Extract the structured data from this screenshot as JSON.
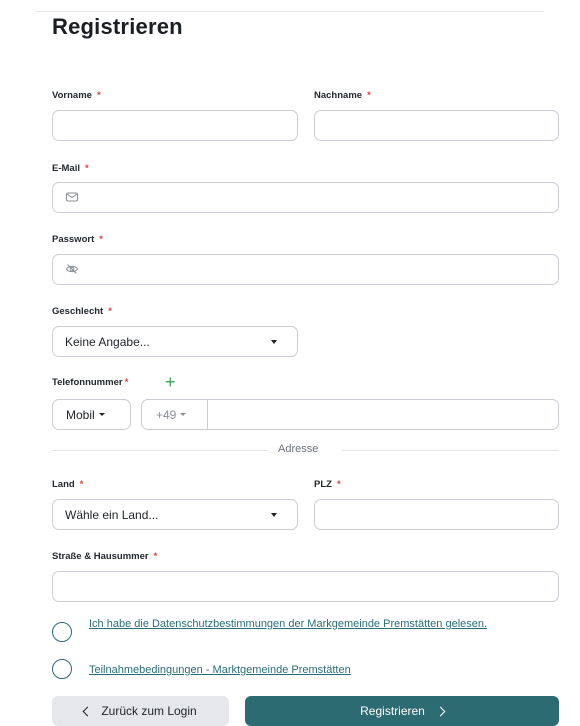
{
  "title": "Registrieren",
  "required_marker": "*",
  "fields": {
    "vorname": {
      "label": "Vorname",
      "value": ""
    },
    "nachname": {
      "label": "Nachname",
      "value": ""
    },
    "email": {
      "label": "E-Mail",
      "value": "",
      "icon": "mail-icon"
    },
    "passwort": {
      "label": "Passwort",
      "value": "",
      "icon": "eye-off-icon"
    },
    "geschlecht": {
      "label": "Geschlecht",
      "selected": "Keine Angabe..."
    },
    "telefon": {
      "label": "Telefonnummer",
      "type_selected": "Mobil",
      "prefix": "+49",
      "value": ""
    },
    "land": {
      "label": "Land",
      "selected": "Wähle ein Land..."
    },
    "plz": {
      "label": "PLZ",
      "value": ""
    },
    "strasse": {
      "label": "Straße & Hausummer",
      "value": ""
    }
  },
  "section_address": "Adresse",
  "consents": [
    {
      "text": "Ich habe die Datenschutzbestimmungen der Markgemeinde Premstätten gelesen.",
      "checked": false
    },
    {
      "text": "Teilnahmebedingungen - Marktgemeinde Premstätten",
      "checked": false
    }
  ],
  "buttons": {
    "back": "Zurück zum Login",
    "register": "Registrieren"
  },
  "colors": {
    "primary": "#2d6b73",
    "required": "#e0403a",
    "add": "#3aa55a",
    "secondary_bg": "#e5e7ea"
  }
}
